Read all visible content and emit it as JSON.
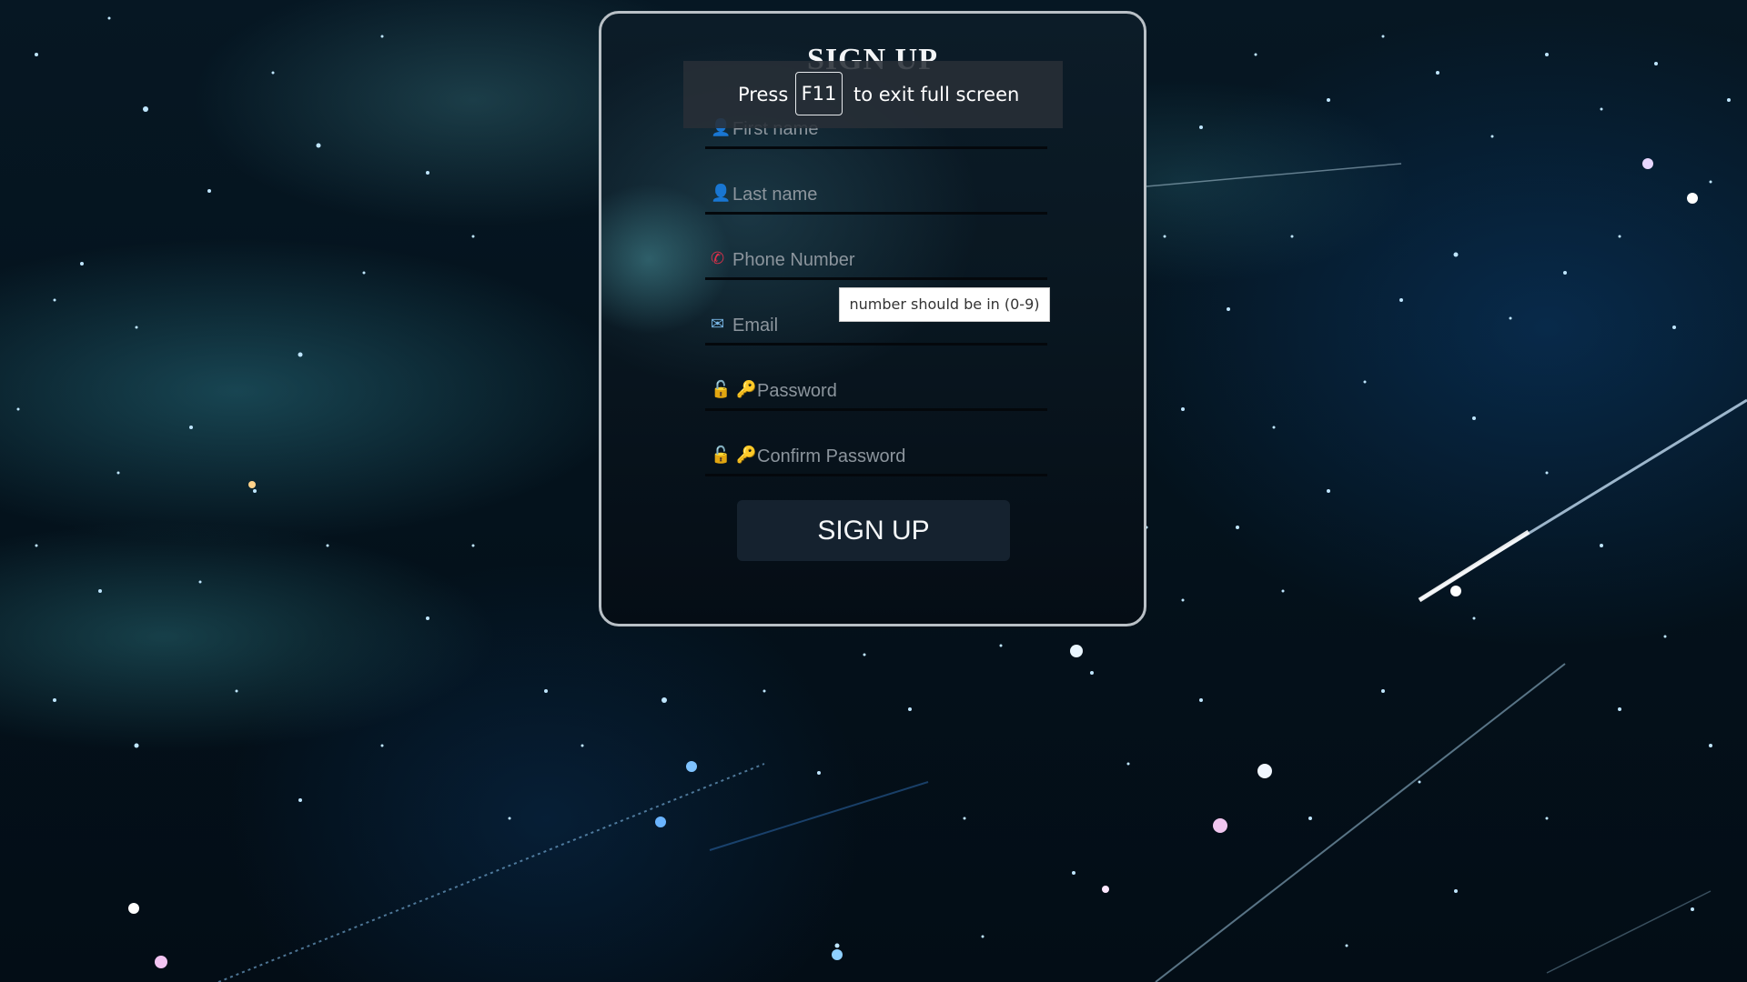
{
  "form": {
    "title": "SIGN UP",
    "fields": [
      {
        "name": "first-name",
        "placeholder": "First name",
        "icon": "person-icon"
      },
      {
        "name": "last-name",
        "placeholder": "Last name",
        "icon": "person-icon"
      },
      {
        "name": "phone-number",
        "placeholder": "Phone Number",
        "icon": "phone-icon"
      },
      {
        "name": "email",
        "placeholder": "Email",
        "icon": "email-card-icon"
      },
      {
        "name": "password",
        "placeholder": "Password",
        "icon": "lock-key-icon"
      },
      {
        "name": "confirm-password",
        "placeholder": "Confirm Password",
        "icon": "lock-key-icon"
      }
    ],
    "submit_label": "SIGN UP"
  },
  "fullscreen_notice": {
    "before": "Press",
    "key": "F11",
    "after": "to exit full screen"
  },
  "validation_tooltip": {
    "text": "number should be in (0-9)"
  },
  "colors": {
    "card_border": "#b9c0c6",
    "button_bg": "#15222f",
    "placeholder": "#8c959d",
    "background": "#04121c"
  }
}
